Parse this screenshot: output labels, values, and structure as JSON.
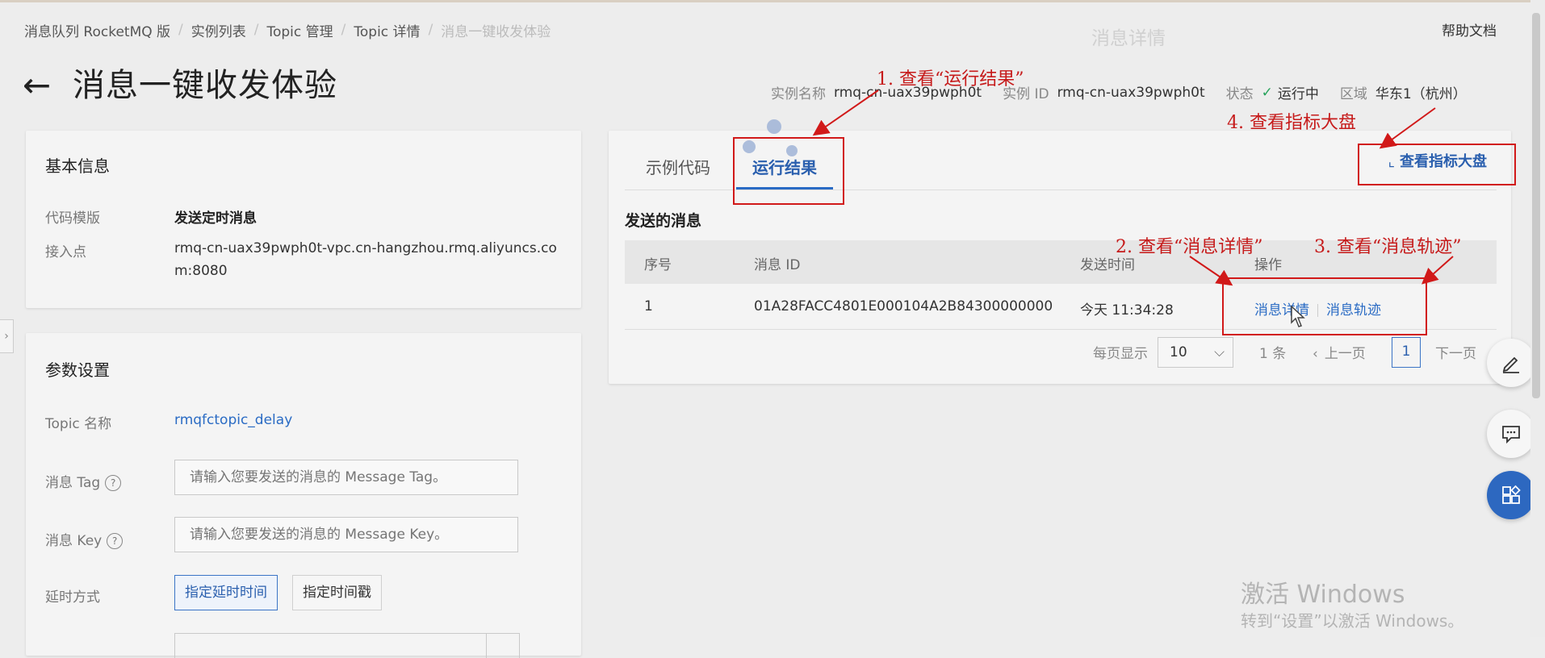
{
  "breadcrumb": {
    "items": [
      "消息队列 RocketMQ 版",
      "实例列表",
      "Topic 管理",
      "Topic 详情"
    ],
    "current": "消息一键收发体验"
  },
  "help_link": "帮助文档",
  "watermark_title": "消息详情",
  "page_title": "消息一键收发体验",
  "instance_meta": {
    "name_label": "实例名称",
    "name_value": "rmq-cn-uax39pwph0t",
    "id_label": "实例 ID",
    "id_value": "rmq-cn-uax39pwph0t",
    "status_label": "状态",
    "status_value": "运行中",
    "region_label": "区域",
    "region_value": "华东1（杭州）"
  },
  "basic_info": {
    "title": "基本信息",
    "template_label": "代码模版",
    "template_value": "发送定时消息",
    "endpoint_label": "接入点",
    "endpoint_line1": "rmq-cn-uax39pwph0t-vpc.cn-hangzhou.rmq.aliyuncs.co",
    "endpoint_line2": "m:8080"
  },
  "params": {
    "title": "参数设置",
    "topic_label": "Topic 名称",
    "topic_value": "rmqfctopic_delay",
    "tag_label": "消息 Tag",
    "tag_placeholder": "请输入您要发送的消息的 Message Tag。",
    "key_label": "消息 Key",
    "key_placeholder": "请输入您要发送的消息的 Message Key。",
    "delay_label": "延时方式",
    "delay_options": [
      "指定延时时间",
      "指定时间戳"
    ],
    "delay_selected": "指定延时时间"
  },
  "result": {
    "tabs": [
      "示例代码",
      "运行结果"
    ],
    "active_tab": "运行结果",
    "dashboard_button": "查看指标大盘",
    "section_title": "发送的消息",
    "columns": [
      "序号",
      "消息 ID",
      "发送时间",
      "操作"
    ],
    "rows": [
      {
        "index": "1",
        "message_id": "01A28FACC4801E000104A2B84300000000",
        "send_time": "今天 11:34:28",
        "actions": [
          "消息详情",
          "消息轨迹"
        ]
      }
    ],
    "pager": {
      "per_page_label": "每页显示",
      "per_page_value": "10",
      "total": "1 条",
      "prev": "上一页",
      "current_page": "1",
      "next": "下一页"
    }
  },
  "annotations": {
    "a1": "1. 查看“运行结果”",
    "a2": "2. 查看“消息详情”",
    "a3": "3. 查看“消息轨迹”",
    "a4": "4. 查看指标大盘"
  },
  "os_watermark": {
    "line1": "激活 Windows",
    "line2": "转到“设置”以激活 Windows。"
  },
  "colors": {
    "accent": "#2a6bc4",
    "annotation_red": "#d11919",
    "status_green": "#25a25a"
  }
}
